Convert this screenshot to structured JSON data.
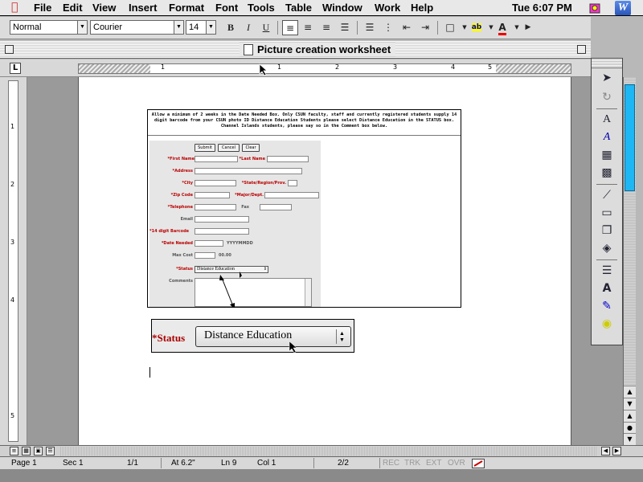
{
  "menubar": {
    "items": [
      "File",
      "Edit",
      "View",
      "Insert",
      "Format",
      "Font",
      "Tools",
      "Table",
      "Window",
      "Work",
      "Help"
    ],
    "clock": "Tue 6:07 PM"
  },
  "format_toolbar": {
    "style": "Normal",
    "font": "Courier",
    "size": "14",
    "bold": "B",
    "italic": "I",
    "underline": "U"
  },
  "window": {
    "title": "Picture creation worksheet"
  },
  "ruler": {
    "numbers": [
      "1",
      "1",
      "2",
      "3",
      "4",
      "5"
    ],
    "tab_button": "L"
  },
  "vruler": {
    "numbers": [
      "1",
      "2",
      "3",
      "4",
      "5"
    ]
  },
  "form_picture": {
    "instructions": "Allow a minimum of 2 weeks in the Date Needed Box. Only CSUN faculty, staff and currently registered students supply 14 digit barcode from your CSUN photo ID Distance Education Students please select Distance Education in the STATUS box. Channel Islands students, please say so in the Comment box below.",
    "buttons": [
      "Submit",
      "Cancel",
      "Clear"
    ],
    "labels": {
      "first_name": "*First Name",
      "last_name": "*Last Name",
      "address": "*Address",
      "city": "*City",
      "state": "*State/Region/Prov.",
      "zip": "*Zip Code",
      "major": "*Major/Dept.",
      "telephone": "*Telephone",
      "fax": "Fax",
      "email": "Email",
      "barcode": "*14 digit Barcode",
      "date_needed": "*Date Needed",
      "max_cost": "Max Cost",
      "status": "*Status",
      "comments": "Comments"
    },
    "date_hint": "YYYYMMDD",
    "cost_hint": "00.00",
    "status_value": "Distance Education"
  },
  "status_picture": {
    "label": "*Status",
    "value": "Distance Education"
  },
  "statusbar": {
    "page": "Page 1",
    "sec": "Sec 1",
    "page_of": "1/1",
    "at": "At 6.2\"",
    "ln": "Ln 9",
    "col": "Col 1",
    "count": "2/2",
    "rec": "REC",
    "trk": "TRK",
    "ext": "EXT",
    "ovr": "OVR"
  },
  "colors": {
    "accent_blue": "#1fb7f3",
    "required_red": "#b00000"
  },
  "icons": [
    "apple-icon",
    "finder-icon",
    "app-icon",
    "align-left-icon",
    "align-center-icon",
    "align-right-icon",
    "justify-icon",
    "numbered-list-icon",
    "bulleted-list-icon",
    "outdent-icon",
    "indent-icon",
    "border-icon",
    "highlight-icon",
    "font-color-icon",
    "select-arrow-icon",
    "free-rotate-icon",
    "wordart-icon",
    "vertical-text-icon",
    "insert-picture-icon",
    "line-icon",
    "rectangle-icon",
    "shapes-icon",
    "fill-color-icon",
    "line-color-icon"
  ]
}
